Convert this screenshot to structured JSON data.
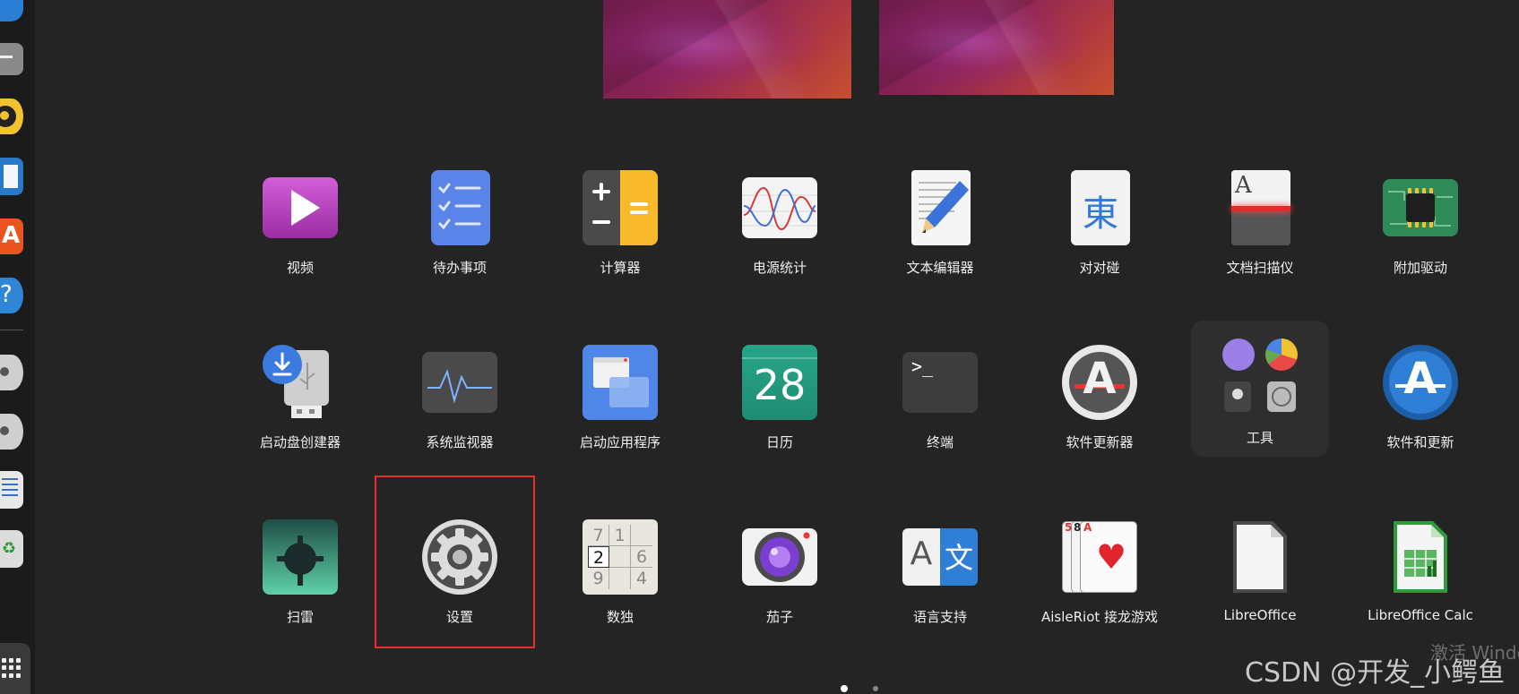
{
  "apps": [
    {
      "label": "视频",
      "icon": "video-icon"
    },
    {
      "label": "待办事项",
      "icon": "todo-icon"
    },
    {
      "label": "计算器",
      "icon": "calculator-icon"
    },
    {
      "label": "电源统计",
      "icon": "power-statistics-icon"
    },
    {
      "label": "文本编辑器",
      "icon": "text-editor-icon"
    },
    {
      "label": "对对碰",
      "icon": "mahjong-icon",
      "glyph": "東"
    },
    {
      "label": "文档扫描仪",
      "icon": "document-scanner-icon",
      "glyph": "A"
    },
    {
      "label": "附加驱动",
      "icon": "additional-drivers-icon"
    },
    {
      "label": "启动盘创建器",
      "icon": "startup-disk-creator-icon"
    },
    {
      "label": "系统监视器",
      "icon": "system-monitor-icon"
    },
    {
      "label": "启动应用程序",
      "icon": "startup-applications-icon"
    },
    {
      "label": "日历",
      "icon": "calendar-icon",
      "glyph": "28"
    },
    {
      "label": "终端",
      "icon": "terminal-icon",
      "glyph": ">_"
    },
    {
      "label": "软件更新器",
      "icon": "software-updater-icon",
      "glyph": "A"
    },
    {
      "label": "工具",
      "icon": "utilities-folder-icon"
    },
    {
      "label": "软件和更新",
      "icon": "software-and-updates-icon",
      "glyph": "A"
    },
    {
      "label": "扫雷",
      "icon": "mines-icon"
    },
    {
      "label": "设置",
      "icon": "settings-gear-icon"
    },
    {
      "label": "数独",
      "icon": "sudoku-icon",
      "cells": [
        "7",
        "1",
        "",
        "2",
        "",
        "6",
        "9",
        "",
        "4"
      ]
    },
    {
      "label": "茄子",
      "icon": "cheese-camera-icon"
    },
    {
      "label": "语言支持",
      "icon": "language-support-icon",
      "glyphs": [
        "A",
        "文"
      ]
    },
    {
      "label": "AisleRiot 接龙游戏",
      "icon": "aisleriot-cards-icon",
      "cards": [
        "5",
        "8",
        "A"
      ]
    },
    {
      "label": "LibreOffice",
      "icon": "libreoffice-icon"
    },
    {
      "label": "LibreOffice Calc",
      "icon": "libreoffice-calc-icon"
    }
  ],
  "watermark": {
    "text": "CSDN @开发_小鳄鱼",
    "activate_text": "激活 Windo"
  },
  "colors": {
    "highlight": "#e0312f",
    "background": "#242424",
    "dock": "#1b1b1b"
  }
}
